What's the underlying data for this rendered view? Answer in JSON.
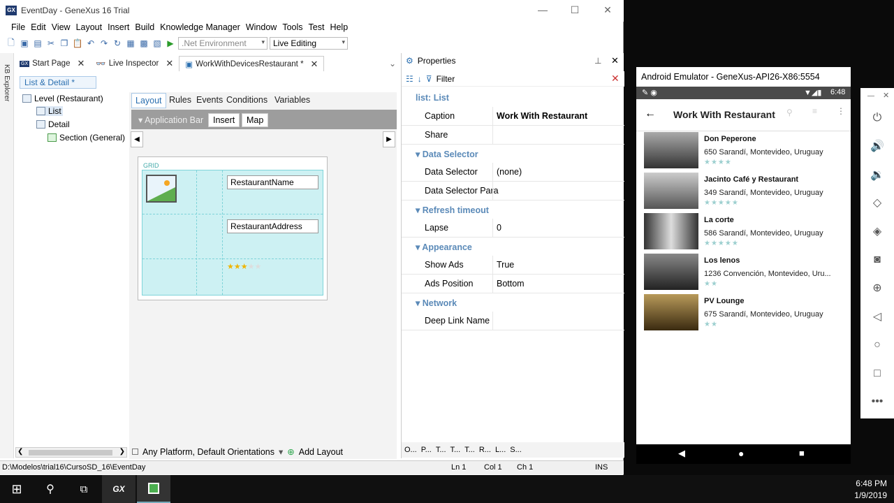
{
  "window": {
    "title": "EventDay - GeneXus 16 Trial",
    "logo": "GX"
  },
  "menu": [
    "File",
    "Edit",
    "View",
    "Layout",
    "Insert",
    "Build",
    "Knowledge Manager",
    "Window",
    "Tools",
    "Test",
    "Help"
  ],
  "toolbar": {
    "environment": ".Net Environment",
    "mode": "Live Editing"
  },
  "kb_explorer": "KB Explorer",
  "tabs": [
    {
      "label": "Start Page"
    },
    {
      "label": "Live Inspector"
    },
    {
      "label": "WorkWithDevicesRestaurant *"
    }
  ],
  "left": {
    "title": "List & Detail *",
    "tree": [
      "Level (Restaurant)",
      "List",
      "Detail",
      "Section (General)"
    ]
  },
  "design": {
    "tabs": [
      "Layout",
      "Rules",
      "Events",
      "Conditions",
      "Variables"
    ],
    "appbar": {
      "label": "Application Bar",
      "insert": "Insert",
      "map": "Map"
    },
    "grid": {
      "label": "GRID",
      "name_field": "RestaurantName",
      "address_field": "RestaurantAddress",
      "rating_value": 3,
      "rating_max": 5
    },
    "bottom": {
      "platform": "Any Platform, Default Orientations",
      "add_layout": "Add Layout"
    }
  },
  "properties": {
    "title": "Properties",
    "filter": "Filter",
    "object": "list: List",
    "rows": [
      {
        "k": "Caption",
        "v": "Work With Restaurant",
        "bold": true
      },
      {
        "k": "Share",
        "v": ""
      },
      {
        "sec": "Data Selector"
      },
      {
        "k": "Data Selector",
        "v": "(none)"
      },
      {
        "k": "Data Selector Para",
        "v": ""
      },
      {
        "sec": "Refresh timeout"
      },
      {
        "k": "Lapse",
        "v": "0"
      },
      {
        "sec": "Appearance"
      },
      {
        "k": "Show Ads",
        "v": "True"
      },
      {
        "k": "Ads Position",
        "v": "Bottom"
      },
      {
        "sec": "Network"
      },
      {
        "k": "Deep Link Name",
        "v": ""
      }
    ],
    "bottom_tabs": [
      "O...",
      "P...",
      "T...",
      "T...",
      "T...",
      "R...",
      "L...",
      "S..."
    ]
  },
  "status": {
    "path": "D:\\Modelos\\trial16\\CursoSD_16\\EventDay",
    "ln": "Ln 1",
    "col": "Col 1",
    "ch": "Ch 1",
    "ins": "INS"
  },
  "emulator": {
    "title": "Android Emulator - GeneXus-API26-X86:5554",
    "time": "6:48",
    "app_title": "Work With Restaurant",
    "restaurants": [
      {
        "name": "Don Peperone",
        "address": "650 Sarandí, Montevideo, Uruguay",
        "rating": 0,
        "stars": "★★★★"
      },
      {
        "name": "Jacinto Café y Restaurant",
        "address": "349 Sarandí, Montevideo, Uruguay",
        "rating": 0,
        "stars": "★★★★★"
      },
      {
        "name": "La corte",
        "address": "586 Sarandí, Montevideo, Uruguay",
        "rating": 0,
        "stars": "★★★★★"
      },
      {
        "name": "Los lenos",
        "address": "1236 Convención, Montevideo, Uru...",
        "rating": 0,
        "stars": "★★"
      },
      {
        "name": "PV Lounge",
        "address": "675 Sarandí, Montevideo, Uruguay",
        "rating": 0,
        "stars": "★★"
      }
    ]
  },
  "taskbar": {
    "gx": "GX",
    "time": "6:48 PM",
    "date": "1/9/2019"
  }
}
